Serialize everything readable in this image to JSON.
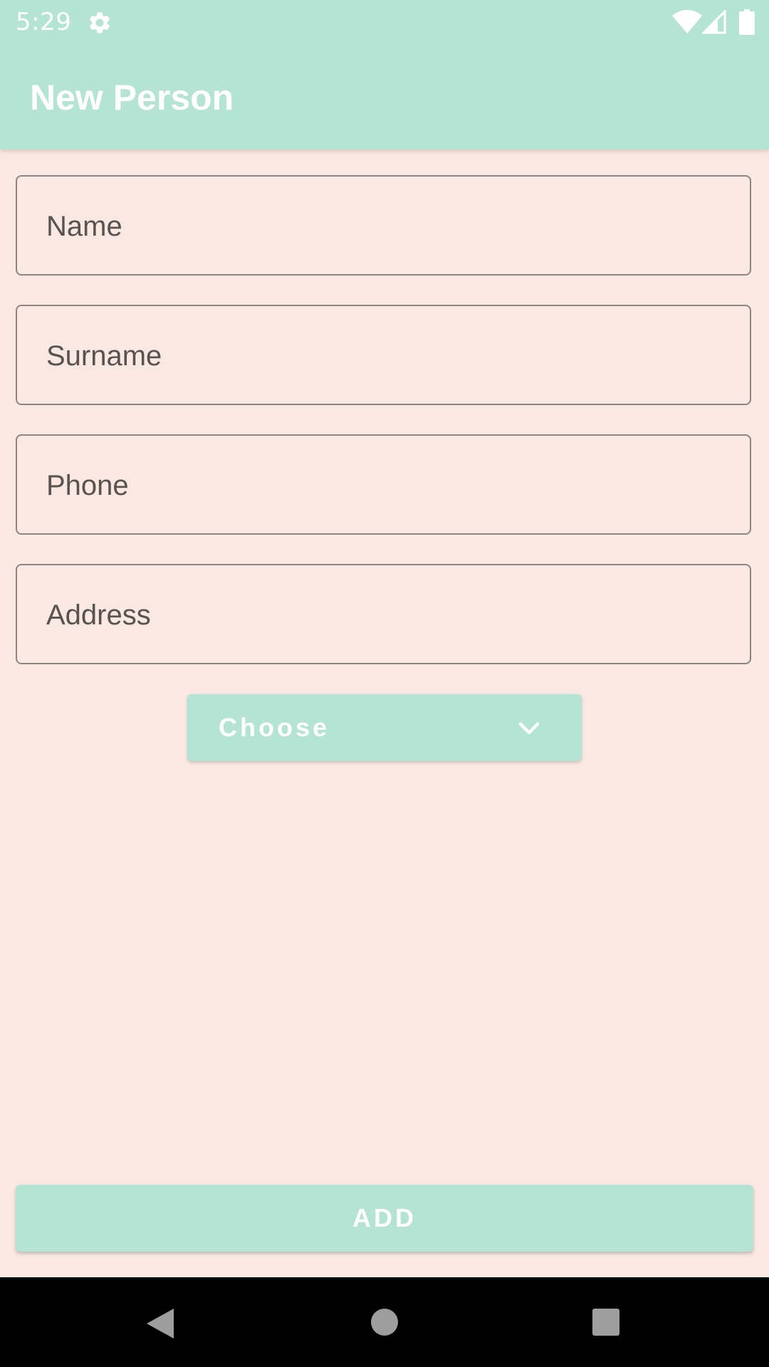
{
  "status_bar": {
    "time": "5:29",
    "icons": [
      "gear-icon",
      "wifi-icon",
      "signal-icon",
      "battery-icon"
    ]
  },
  "app_bar": {
    "title": "New Person"
  },
  "form": {
    "name_placeholder": "Name",
    "surname_placeholder": "Surname",
    "phone_placeholder": "Phone",
    "address_placeholder": "Address",
    "dropdown_label": "Choose",
    "dropdown_icon": "chevron-down-icon"
  },
  "actions": {
    "add_label": "ADD"
  },
  "nav_bar": {
    "icons": [
      "back-icon",
      "home-icon",
      "recents-icon"
    ]
  },
  "colors": {
    "accent": "#B5E3D4",
    "background": "#FAE8E2",
    "field_border": "#8E8482",
    "placeholder_text": "#5A5250"
  }
}
